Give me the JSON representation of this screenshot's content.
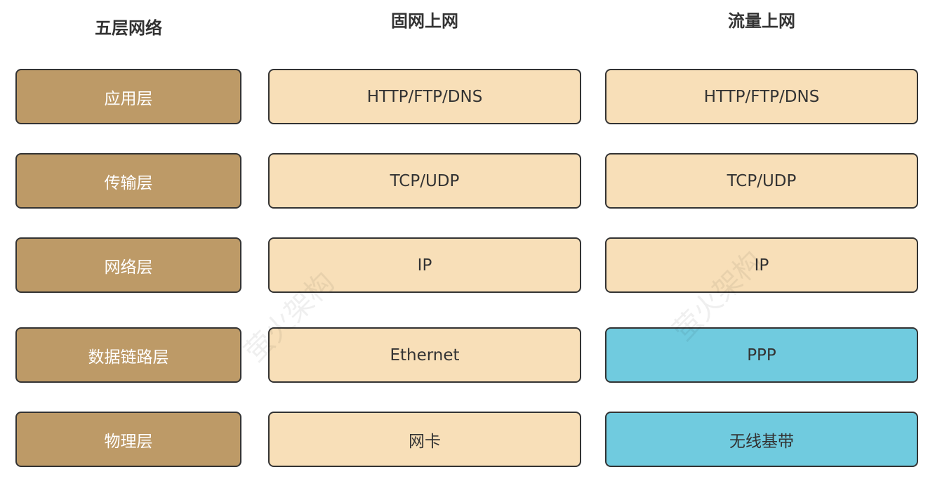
{
  "headers": {
    "layers": "五层网络",
    "fixed": "固网上网",
    "mobile": "流量上网"
  },
  "rows": [
    {
      "layer": "应用层",
      "fixed": "HTTP/FTP/DNS",
      "mobile": "HTTP/FTP/DNS",
      "mobile_highlight": false
    },
    {
      "layer": "传输层",
      "fixed": "TCP/UDP",
      "mobile": "TCP/UDP",
      "mobile_highlight": false
    },
    {
      "layer": "网络层",
      "fixed": "IP",
      "mobile": "IP",
      "mobile_highlight": false
    },
    {
      "layer": "数据链路层",
      "fixed": "Ethernet",
      "mobile": "PPP",
      "mobile_highlight": true
    },
    {
      "layer": "物理层",
      "fixed": "网卡",
      "mobile": "无线基带",
      "mobile_highlight": true
    }
  ],
  "watermark": "萤火架构",
  "colors": {
    "layer_fill": "#bd9a67",
    "common_fill": "#f8dfb8",
    "diff_fill": "#70cbdf",
    "border": "#333333"
  }
}
